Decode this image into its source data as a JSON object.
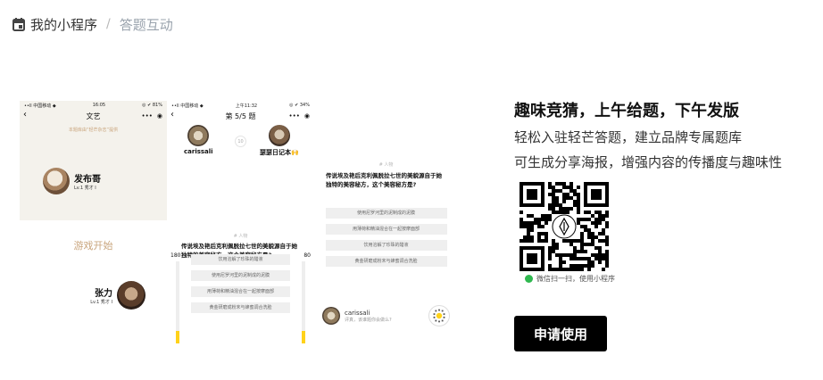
{
  "breadcrumb": {
    "home": "我的小程序",
    "separator": "/",
    "current": "答题互动"
  },
  "phone_a": {
    "status_left": "••ll 中国移动 ◆",
    "status_time": "16:05",
    "status_right": "◎ ✔ 81%",
    "nav_title": "文艺",
    "hint": "本题库由“轻芒杂志”提供",
    "player1": {
      "name": "发布哥",
      "level": "Lv.1 秀才 I"
    },
    "start_label": "游戏开始",
    "player2": {
      "name": "张力",
      "level": "Lv.1 秀才 I"
    }
  },
  "phone_b": {
    "status_left": "••ll 中国移动 ◆",
    "status_time": "上午11:32",
    "status_right": "◎ ✔ 34%",
    "nav_title": "第 5/5 题",
    "player_left": "carissali",
    "player_right": "瑟瑟日记本🙌",
    "vs": "10",
    "tag": "# 人物",
    "question": "传说埃及艳后克利佩脱拉七世的美貌源自于她独特的美容秘方，这个美容秘方是?",
    "score_left": "180",
    "score_right": "80",
    "score_left_pct": 0.15,
    "score_right_pct": 0.15,
    "options": [
      "饮用溶解了珍珠的醋液",
      "使用尼罗河里的泥制成的泥膜",
      "用薄荷和精油混合在一起按摩面部",
      "黄金研磨成粉末与蜂蜜调合洗脸"
    ]
  },
  "phone_c": {
    "tag": "# 人物",
    "question": "传说埃及艳后克利佩脱拉七世的美貌源自于她独特的美容秘方，这个美容秘方是?",
    "options": [
      "使用尼罗河里的泥制成的泥膜",
      "用薄荷和精油混合在一起按摩面部",
      "饮用溶解了珍珠的醋液",
      "黄金研磨成粉末与蜂蜜调合洗脸"
    ],
    "comment_name": "carissali",
    "comment_text": "评真，该谁题你会做么?"
  },
  "promo": {
    "title": "趣味竞猜，上午给题，下午发版",
    "line1": "轻松入驻轻芒答题，建立品牌专属题库",
    "line2": "可生成分享海报，增强内容的传播度与趣味性",
    "qr_caption": "微信扫一扫，使用小程序",
    "apply_label": "申请使用"
  }
}
